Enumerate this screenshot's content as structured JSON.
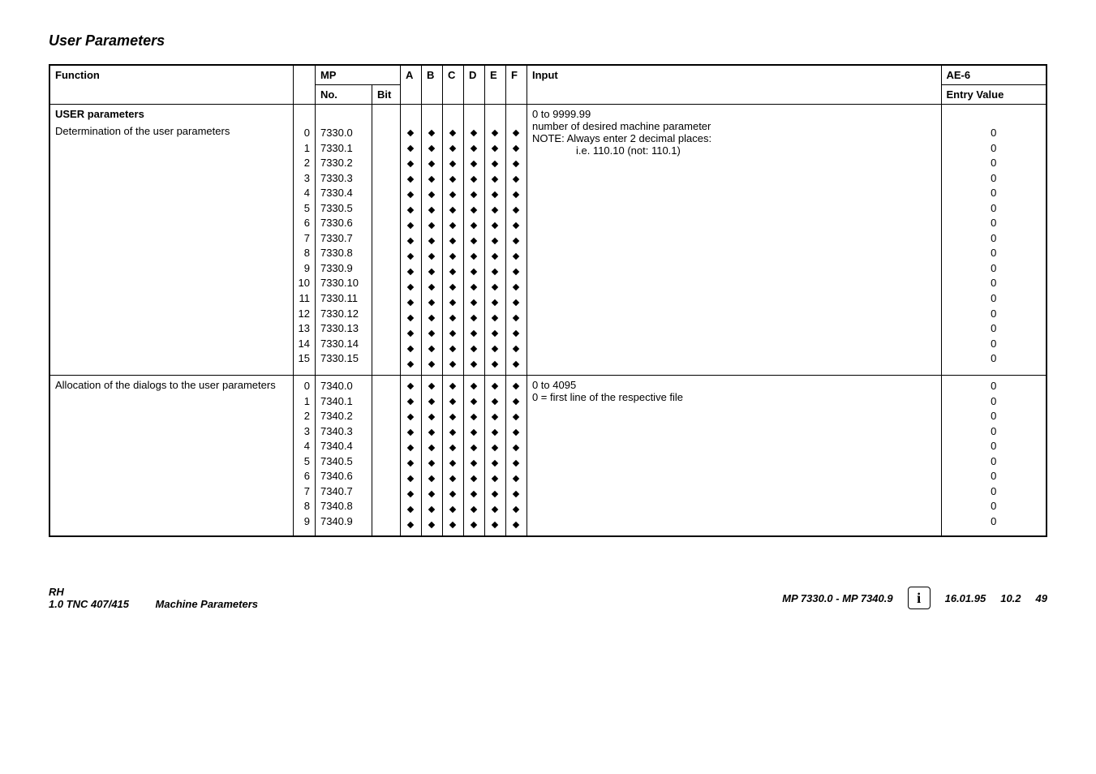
{
  "title": "User Parameters",
  "headers": {
    "function": "Function",
    "mp": "MP",
    "mp_no": "No.",
    "mp_bit": "Bit",
    "A": "A",
    "B": "B",
    "C": "C",
    "D": "D",
    "E": "E",
    "F": "F",
    "input": "Input",
    "ae6": "AE-6",
    "entry_value": "Entry Value"
  },
  "section1": {
    "heading": "USER parameters",
    "function": "Determination of the user parameters",
    "indices": [
      "0",
      "1",
      "2",
      "3",
      "4",
      "5",
      "6",
      "7",
      "8",
      "9",
      "10",
      "11",
      "12",
      "13",
      "14",
      "15"
    ],
    "mpnos": [
      "7330.0",
      "7330.1",
      "7330.2",
      "7330.3",
      "7330.4",
      "7330.5",
      "7330.6",
      "7330.7",
      "7330.8",
      "7330.9",
      "7330.10",
      "7330.11",
      "7330.12",
      "7330.13",
      "7330.14",
      "7330.15"
    ],
    "input_l1": "0 to 9999.99",
    "input_l2": "number of desired machine parameter",
    "input_l3": "NOTE:   Always enter 2 decimal places:",
    "input_l4": "i.e. 110.10 (not: 110.1)",
    "entries": [
      "0",
      "0",
      "0",
      "0",
      "0",
      "0",
      "0",
      "0",
      "0",
      "0",
      "0",
      "0",
      "0",
      "0",
      "0",
      "0"
    ]
  },
  "section2": {
    "function": "Allocation of the dialogs to the user parameters",
    "indices": [
      "0",
      "1",
      "2",
      "3",
      "4",
      "5",
      "6",
      "7",
      "8",
      "9"
    ],
    "mpnos": [
      "7340.0",
      "7340.1",
      "7340.2",
      "7340.3",
      "7340.4",
      "7340.5",
      "7340.6",
      "7340.7",
      "7340.8",
      "7340.9"
    ],
    "input_l1": "0 to 4095",
    "input_l2": "0 = first line of the respective file",
    "entries": [
      "0",
      "0",
      "0",
      "0",
      "0",
      "0",
      "0",
      "0",
      "0",
      "0"
    ]
  },
  "footer": {
    "left_l1": "RH",
    "left_l2": "1.0  TNC 407/415",
    "mid": "Machine Parameters",
    "mp_range": "MP 7330.0 - MP 7340.9",
    "date": "16.01.95",
    "sec": "10.2",
    "page": "49"
  },
  "chart_data": {
    "type": "table",
    "title": "User Parameters",
    "columns": [
      "Function",
      "Index",
      "MP No.",
      "Bit",
      "A",
      "B",
      "C",
      "D",
      "E",
      "F",
      "Input",
      "AE-6 Entry Value"
    ],
    "rows": [
      {
        "function": "Determination of the user parameters",
        "index": 0,
        "mp_no": "7330.0",
        "A": true,
        "B": true,
        "C": true,
        "D": true,
        "E": true,
        "F": true,
        "input": "0 to 9999.99; number of desired machine parameter",
        "entry": 0
      },
      {
        "function": "Determination of the user parameters",
        "index": 1,
        "mp_no": "7330.1",
        "A": true,
        "B": true,
        "C": true,
        "D": true,
        "E": true,
        "F": true,
        "entry": 0
      },
      {
        "function": "Determination of the user parameters",
        "index": 2,
        "mp_no": "7330.2",
        "A": true,
        "B": true,
        "C": true,
        "D": true,
        "E": true,
        "F": true,
        "entry": 0
      },
      {
        "function": "Determination of the user parameters",
        "index": 3,
        "mp_no": "7330.3",
        "A": true,
        "B": true,
        "C": true,
        "D": true,
        "E": true,
        "F": true,
        "entry": 0
      },
      {
        "function": "Determination of the user parameters",
        "index": 4,
        "mp_no": "7330.4",
        "A": true,
        "B": true,
        "C": true,
        "D": true,
        "E": true,
        "F": true,
        "entry": 0
      },
      {
        "function": "Determination of the user parameters",
        "index": 5,
        "mp_no": "7330.5",
        "A": true,
        "B": true,
        "C": true,
        "D": true,
        "E": true,
        "F": true,
        "entry": 0
      },
      {
        "function": "Determination of the user parameters",
        "index": 6,
        "mp_no": "7330.6",
        "A": true,
        "B": true,
        "C": true,
        "D": true,
        "E": true,
        "F": true,
        "entry": 0
      },
      {
        "function": "Determination of the user parameters",
        "index": 7,
        "mp_no": "7330.7",
        "A": true,
        "B": true,
        "C": true,
        "D": true,
        "E": true,
        "F": true,
        "entry": 0
      },
      {
        "function": "Determination of the user parameters",
        "index": 8,
        "mp_no": "7330.8",
        "A": true,
        "B": true,
        "C": true,
        "D": true,
        "E": true,
        "F": true,
        "entry": 0
      },
      {
        "function": "Determination of the user parameters",
        "index": 9,
        "mp_no": "7330.9",
        "A": true,
        "B": true,
        "C": true,
        "D": true,
        "E": true,
        "F": true,
        "entry": 0
      },
      {
        "function": "Determination of the user parameters",
        "index": 10,
        "mp_no": "7330.10",
        "A": true,
        "B": true,
        "C": true,
        "D": true,
        "E": true,
        "F": true,
        "entry": 0
      },
      {
        "function": "Determination of the user parameters",
        "index": 11,
        "mp_no": "7330.11",
        "A": true,
        "B": true,
        "C": true,
        "D": true,
        "E": true,
        "F": true,
        "entry": 0
      },
      {
        "function": "Determination of the user parameters",
        "index": 12,
        "mp_no": "7330.12",
        "A": true,
        "B": true,
        "C": true,
        "D": true,
        "E": true,
        "F": true,
        "entry": 0
      },
      {
        "function": "Determination of the user parameters",
        "index": 13,
        "mp_no": "7330.13",
        "A": true,
        "B": true,
        "C": true,
        "D": true,
        "E": true,
        "F": true,
        "entry": 0
      },
      {
        "function": "Determination of the user parameters",
        "index": 14,
        "mp_no": "7330.14",
        "A": true,
        "B": true,
        "C": true,
        "D": true,
        "E": true,
        "F": true,
        "entry": 0
      },
      {
        "function": "Determination of the user parameters",
        "index": 15,
        "mp_no": "7330.15",
        "A": true,
        "B": true,
        "C": true,
        "D": true,
        "E": true,
        "F": true,
        "entry": 0
      },
      {
        "function": "Allocation of the dialogs to the user parameters",
        "index": 0,
        "mp_no": "7340.0",
        "A": true,
        "B": true,
        "C": true,
        "D": true,
        "E": true,
        "F": true,
        "input": "0 to 4095; 0 = first line of the respective file",
        "entry": 0
      },
      {
        "function": "Allocation of the dialogs to the user parameters",
        "index": 1,
        "mp_no": "7340.1",
        "A": true,
        "B": true,
        "C": true,
        "D": true,
        "E": true,
        "F": true,
        "entry": 0
      },
      {
        "function": "Allocation of the dialogs to the user parameters",
        "index": 2,
        "mp_no": "7340.2",
        "A": true,
        "B": true,
        "C": true,
        "D": true,
        "E": true,
        "F": true,
        "entry": 0
      },
      {
        "function": "Allocation of the dialogs to the user parameters",
        "index": 3,
        "mp_no": "7340.3",
        "A": true,
        "B": true,
        "C": true,
        "D": true,
        "E": true,
        "F": true,
        "entry": 0
      },
      {
        "function": "Allocation of the dialogs to the user parameters",
        "index": 4,
        "mp_no": "7340.4",
        "A": true,
        "B": true,
        "C": true,
        "D": true,
        "E": true,
        "F": true,
        "entry": 0
      },
      {
        "function": "Allocation of the dialogs to the user parameters",
        "index": 5,
        "mp_no": "7340.5",
        "A": true,
        "B": true,
        "C": true,
        "D": true,
        "E": true,
        "F": true,
        "entry": 0
      },
      {
        "function": "Allocation of the dialogs to the user parameters",
        "index": 6,
        "mp_no": "7340.6",
        "A": true,
        "B": true,
        "C": true,
        "D": true,
        "E": true,
        "F": true,
        "entry": 0
      },
      {
        "function": "Allocation of the dialogs to the user parameters",
        "index": 7,
        "mp_no": "7340.7",
        "A": true,
        "B": true,
        "C": true,
        "D": true,
        "E": true,
        "F": true,
        "entry": 0
      },
      {
        "function": "Allocation of the dialogs to the user parameters",
        "index": 8,
        "mp_no": "7340.8",
        "A": true,
        "B": true,
        "C": true,
        "D": true,
        "E": true,
        "F": true,
        "entry": 0
      },
      {
        "function": "Allocation of the dialogs to the user parameters",
        "index": 9,
        "mp_no": "7340.9",
        "A": true,
        "B": true,
        "C": true,
        "D": true,
        "E": true,
        "F": true,
        "entry": 0
      }
    ]
  }
}
